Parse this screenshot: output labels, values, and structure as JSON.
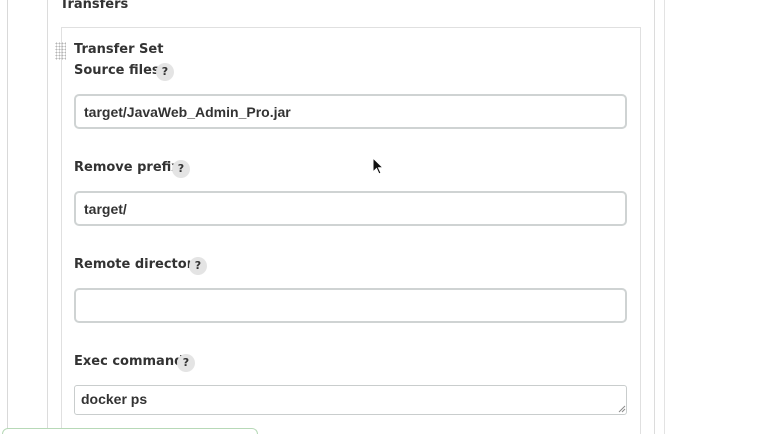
{
  "section": {
    "title": "Transfers"
  },
  "transfer_set": {
    "title": "Transfer Set",
    "fields": {
      "source_files": {
        "label": "Source files",
        "help": "?",
        "value": "target/JavaWeb_Admin_Pro.jar"
      },
      "remove_prefix": {
        "label": "Remove prefix",
        "help": "?",
        "value": "target/"
      },
      "remote_directory": {
        "label": "Remote directory",
        "help": "?",
        "value": ""
      },
      "exec_command": {
        "label": "Exec command",
        "help": "?",
        "value": "docker ps"
      }
    }
  },
  "icons": {
    "drag_handle": "drag-handle-icon",
    "help": "help-icon",
    "resize": "resize-grip-icon",
    "cursor": "mouse-pointer-icon"
  },
  "colors": {
    "input_border": "#cfd3d3",
    "help_bg": "#e4e4e4",
    "text": "#333333",
    "bottom_tab_border": "#b7d9b7"
  }
}
